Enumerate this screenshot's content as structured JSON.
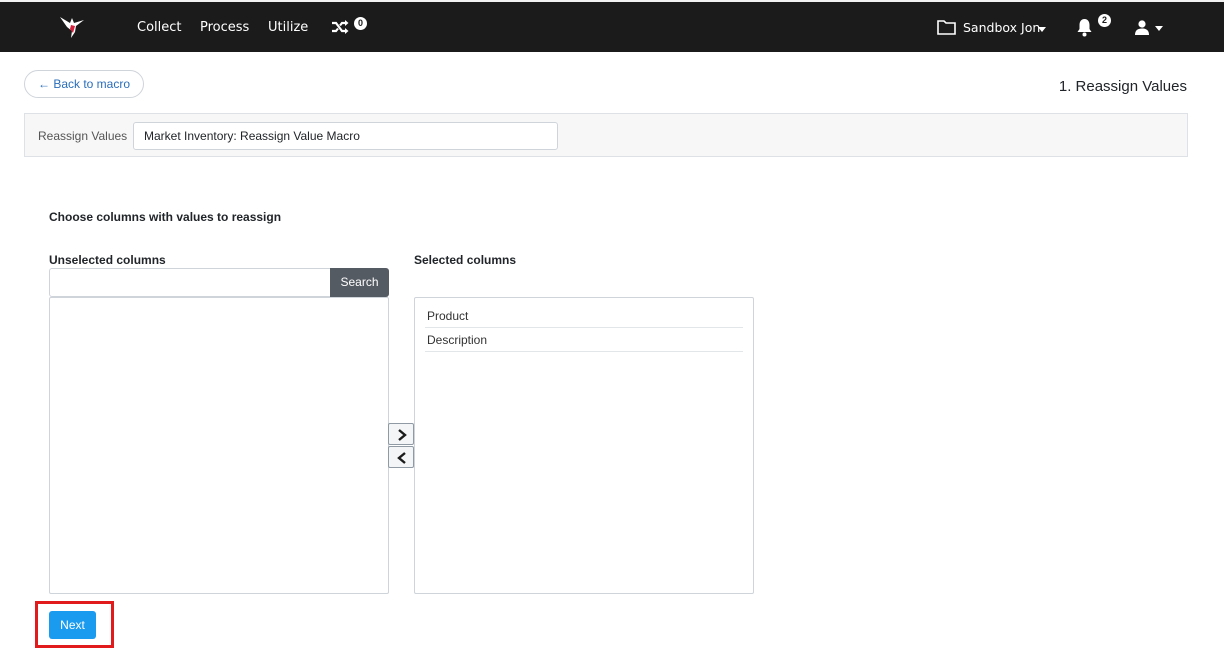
{
  "nav": {
    "collect": "Collect",
    "process": "Process",
    "utilize": "Utilize",
    "shuffle_count": "0",
    "workspace": "Sandbox Jon",
    "notification_count": "2"
  },
  "header": {
    "back_label": "← Back to macro",
    "step_title": "1. Reassign Values"
  },
  "macro": {
    "name_label": "Reassign Values",
    "name_value": "Market Inventory: Reassign Value Macro"
  },
  "columns": {
    "section_title": "Choose columns with values to reassign",
    "unselected_label": "Unselected columns",
    "selected_label": "Selected columns",
    "search_button": "Search",
    "search_value": "",
    "unselected": [],
    "selected": [
      "Product",
      "Description"
    ]
  },
  "footer": {
    "next_label": "Next"
  },
  "colors": {
    "topbar": "#1b1b1b",
    "accent": "#1a9bf0",
    "highlight": "#e11b1b",
    "search_button": "#545b62"
  },
  "icons": {
    "logo": "hummingbird-logo",
    "shuffle": "shuffle-icon",
    "folder": "folder-icon",
    "bell": "bell-icon",
    "user": "user-icon",
    "move_right": "chevron-right-icon",
    "move_left": "chevron-left-icon"
  }
}
